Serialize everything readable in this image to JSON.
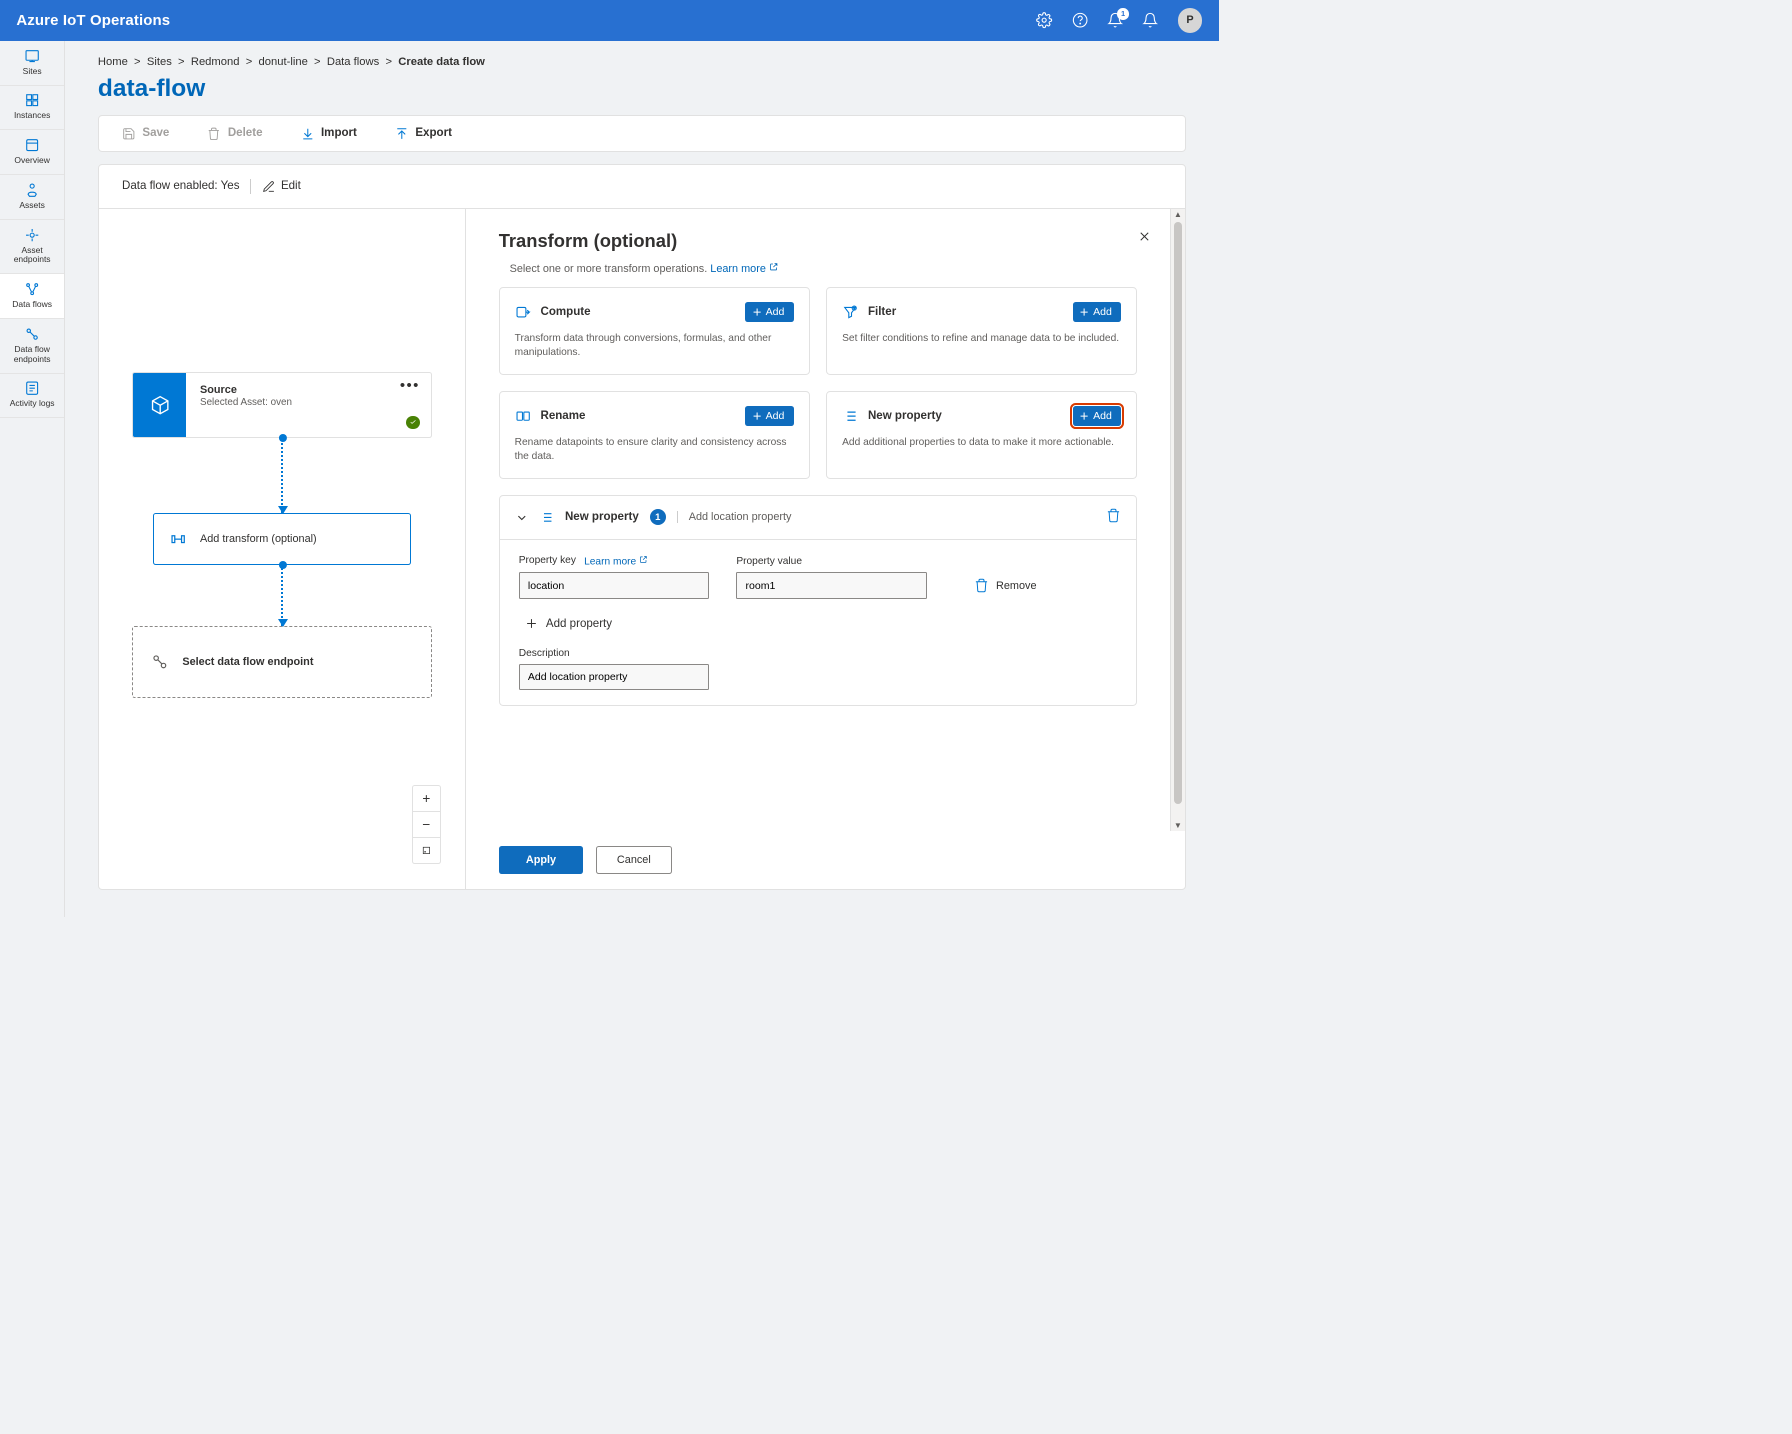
{
  "header": {
    "title": "Azure IoT Operations",
    "notification_count": "1",
    "avatar_initial": "P"
  },
  "sidebar": {
    "items": [
      {
        "label": "Sites"
      },
      {
        "label": "Instances"
      },
      {
        "label": "Overview"
      },
      {
        "label": "Assets"
      },
      {
        "label": "Asset endpoints"
      },
      {
        "label": "Data flows"
      },
      {
        "label": "Data flow endpoints"
      },
      {
        "label": "Activity logs"
      }
    ]
  },
  "breadcrumb": {
    "items": [
      {
        "label": "Home"
      },
      {
        "label": "Sites"
      },
      {
        "label": "Redmond"
      },
      {
        "label": "donut-line"
      },
      {
        "label": "Data flows"
      }
    ],
    "current": "Create data flow"
  },
  "page_title": "data-flow",
  "toolbar": {
    "save": "Save",
    "delete": "Delete",
    "import": "Import",
    "export": "Export"
  },
  "ribbon": {
    "enabled_label": "Data flow enabled: Yes",
    "edit": "Edit"
  },
  "flow": {
    "source_title": "Source",
    "source_sub": "Selected Asset: oven",
    "transform_label": "Add transform (optional)",
    "endpoint_label": "Select data flow endpoint"
  },
  "panel": {
    "title": "Transform (optional)",
    "sub_pre": "Select one or more transform operations. ",
    "learn_more": "Learn more",
    "ops": [
      {
        "title": "Compute",
        "desc": "Transform data through conversions, formulas, and other manipulations.",
        "add": "Add"
      },
      {
        "title": "Filter",
        "desc": "Set filter conditions to refine and manage data to be included.",
        "add": "Add"
      },
      {
        "title": "Rename",
        "desc": "Rename datapoints to ensure clarity and consistency across the data.",
        "add": "Add"
      },
      {
        "title": "New property",
        "desc": "Add additional properties to data to make it more actionable.",
        "add": "Add"
      }
    ],
    "np_section": {
      "title": "New property",
      "count": "1",
      "subtitle": "Add location property",
      "key_label": "Property key",
      "value_label": "Property value",
      "learn_more": "Learn more",
      "key_value": "location",
      "value_value": "room1",
      "remove": "Remove",
      "add_property": "Add property",
      "desc_label": "Description",
      "desc_value": "Add location property"
    },
    "apply": "Apply",
    "cancel": "Cancel"
  }
}
